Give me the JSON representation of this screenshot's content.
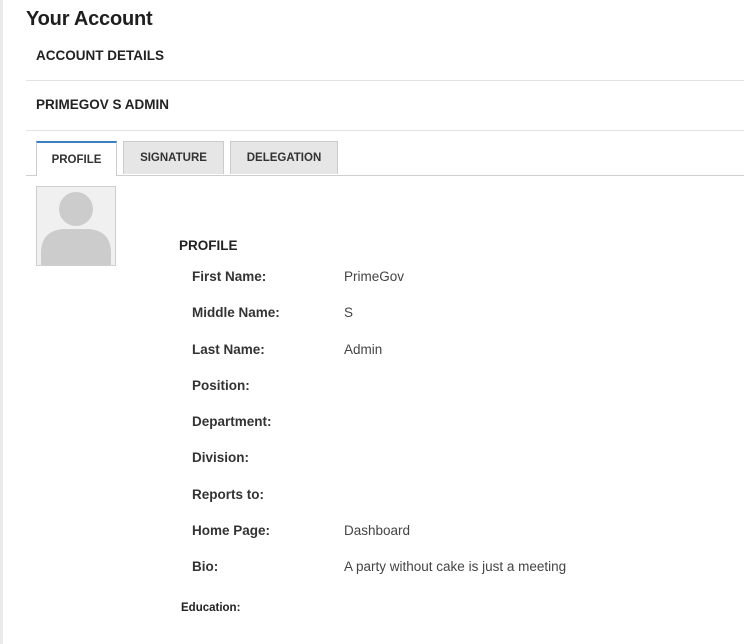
{
  "page": {
    "title": "Your Account"
  },
  "account": {
    "section_label": "ACCOUNT DETAILS",
    "user_name": "PRIMEGOV S ADMIN"
  },
  "tabs": [
    {
      "label": "PROFILE",
      "active": true
    },
    {
      "label": "SIGNATURE",
      "active": false
    },
    {
      "label": "DELEGATION",
      "active": false
    }
  ],
  "avatar": {
    "icon": "user-placeholder-icon"
  },
  "profile": {
    "heading": "PROFILE",
    "fields": [
      {
        "label": "First Name:",
        "value": "PrimeGov"
      },
      {
        "label": "Middle Name:",
        "value": "S"
      },
      {
        "label": "Last Name:",
        "value": "Admin"
      },
      {
        "label": "Position:",
        "value": ""
      },
      {
        "label": "Department:",
        "value": ""
      },
      {
        "label": "Division:",
        "value": ""
      },
      {
        "label": "Reports to:",
        "value": ""
      },
      {
        "label": "Home Page:",
        "value": "Dashboard"
      },
      {
        "label": "Bio:",
        "value": "A party without cake is just a meeting"
      }
    ],
    "education_label": "Education:"
  },
  "colors": {
    "active_tab_accent": "#3a7fc1",
    "inactive_tab_bg": "#e6e6e6",
    "avatar_silhouette": "#cccccc"
  }
}
